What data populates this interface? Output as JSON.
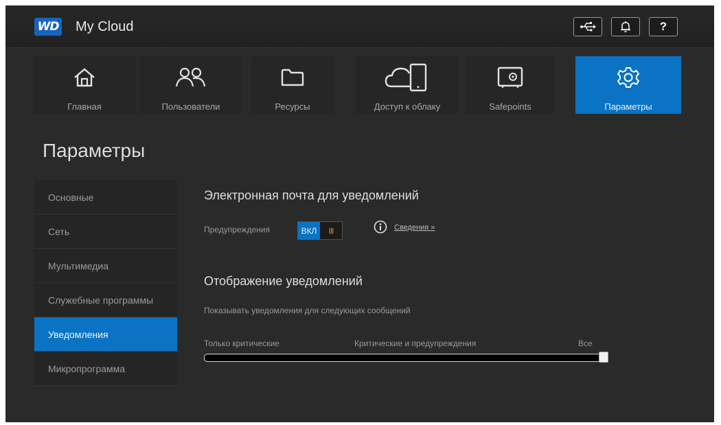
{
  "brand": {
    "logo_text": "WD",
    "app_title": "My Cloud"
  },
  "topbar": {
    "buttons": [
      {
        "name": "usb-icon"
      },
      {
        "name": "bell-icon"
      },
      {
        "name": "help-icon",
        "label": "?"
      }
    ]
  },
  "nav": {
    "items": [
      {
        "label": "Главная",
        "icon": "home-icon",
        "active": false
      },
      {
        "label": "Пользователи",
        "icon": "users-icon",
        "active": false
      },
      {
        "label": "Ресурсы",
        "icon": "folder-icon",
        "active": false
      },
      {
        "label": "Доступ к облаку",
        "icon": "cloud-device-icon",
        "active": false
      },
      {
        "label": "Safepoints",
        "icon": "safe-icon",
        "active": false
      },
      {
        "label": "Параметры",
        "icon": "gear-icon",
        "active": true
      }
    ]
  },
  "page": {
    "title": "Параметры"
  },
  "sidebar": {
    "items": [
      {
        "label": "Основные",
        "active": false
      },
      {
        "label": "Сеть",
        "active": false
      },
      {
        "label": "Мультимедиа",
        "active": false
      },
      {
        "label": "Служебные программы",
        "active": false
      },
      {
        "label": "Уведомления",
        "active": true
      },
      {
        "label": "Микропрограмма",
        "active": false
      }
    ]
  },
  "email_section": {
    "title": "Электронная почта для уведомлений",
    "alerts_label": "Предупреждения",
    "toggle_on": "ВКЛ",
    "toggle_off": "III",
    "toggle_state": "on",
    "details_link": "Сведения »"
  },
  "display_section": {
    "title": "Отображение уведомлений",
    "description": "Показывать уведомления для следующих сообщений",
    "levels": [
      "Только критические",
      "Критические и предупреждения",
      "Все"
    ],
    "selected_level": "Все"
  },
  "colors": {
    "accent": "#0a73c4",
    "background": "#2a2a2a",
    "toggle_off": "#d98d1c"
  }
}
